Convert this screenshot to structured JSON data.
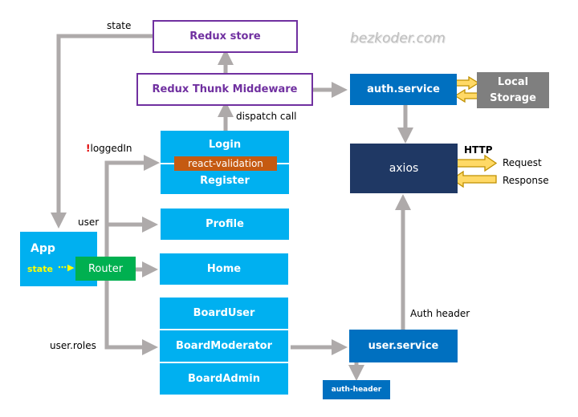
{
  "watermark": "bezkoder.com",
  "nodes": {
    "redux_store": "Redux store",
    "redux_thunk": "Redux Thunk Middeware",
    "auth_service": "auth.service",
    "local_storage_line1": "Local",
    "local_storage_line2": "Storage",
    "axios": "axios",
    "login": "Login",
    "react_validation": "react-validation",
    "register": "Register",
    "profile": "Profile",
    "home": "Home",
    "board_user": "BoardUser",
    "board_moderator": "BoardModerator",
    "board_admin": "BoardAdmin",
    "user_service": "user.service",
    "auth_header": "auth-header",
    "app": "App",
    "app_state": "state",
    "router": "Router"
  },
  "edge_labels": {
    "state": "state",
    "dispatch_call": "dispatch call",
    "not_logged_in_bang": "!",
    "not_logged_in": "loggedIn",
    "user": "user",
    "user_roles": "user.roles",
    "http": "HTTP",
    "request": "Request",
    "response": "Response",
    "auth_header": "Auth header"
  },
  "colors": {
    "purple": "#7030a0",
    "cyan": "#00b0f0",
    "blue": "#0070c0",
    "navy": "#1f3864",
    "gray_box": "#7f7f7f",
    "orange": "#c55a11",
    "green": "#00b050",
    "arrow_gray": "#aeaaaa",
    "gold": "#ffd966",
    "gold_border": "#bf9000",
    "yellow": "#ffff00",
    "red": "#e00000"
  }
}
